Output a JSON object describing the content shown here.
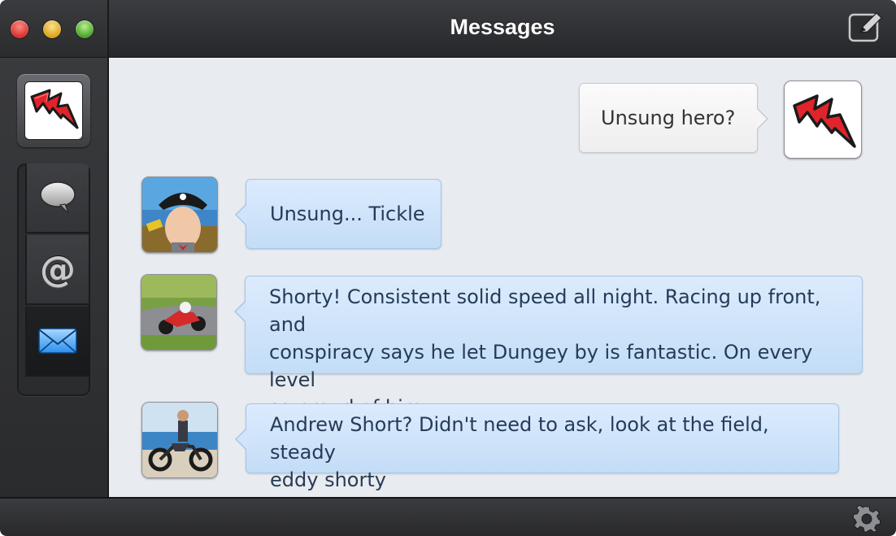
{
  "window": {
    "title": "Messages"
  },
  "sidebar": {
    "account_icon": "red-lightning-logo-icon",
    "tabs": [
      {
        "name": "messages",
        "icon": "speech-bubble-icon",
        "selected": false
      },
      {
        "name": "mentions",
        "icon": "at-sign-icon",
        "selected": false
      },
      {
        "name": "direct-messages",
        "icon": "envelope-icon",
        "selected": true
      }
    ]
  },
  "toolbar": {
    "compose_icon": "compose-icon",
    "settings_icon": "gear-icon"
  },
  "messages": [
    {
      "direction": "outgoing",
      "avatar": "red-lightning-logo",
      "text": "Unsung hero?"
    },
    {
      "direction": "incoming",
      "avatar": "pirate-hat-man-photo",
      "text": "Unsung... Tickle"
    },
    {
      "direction": "incoming",
      "avatar": "motorcycle-racer-photo",
      "lines": [
        "Shorty! Consistent solid speed all night. Racing up front, and",
        "conspiracy says he let Dungey by is fantastic. On every level",
        "so proud of him"
      ]
    },
    {
      "direction": "incoming",
      "avatar": "motocross-rider-photo",
      "lines": [
        "Andrew Short? Didn't need to ask, look at the field, steady",
        "eddy shorty"
      ]
    }
  ],
  "colors": {
    "incoming_bubble": "#c9e0f9",
    "outgoing_bubble": "#f4f4f4",
    "chrome_dark": "#2b2c2e",
    "content_bg": "#e8ebef",
    "brand_red": "#e0242b"
  }
}
